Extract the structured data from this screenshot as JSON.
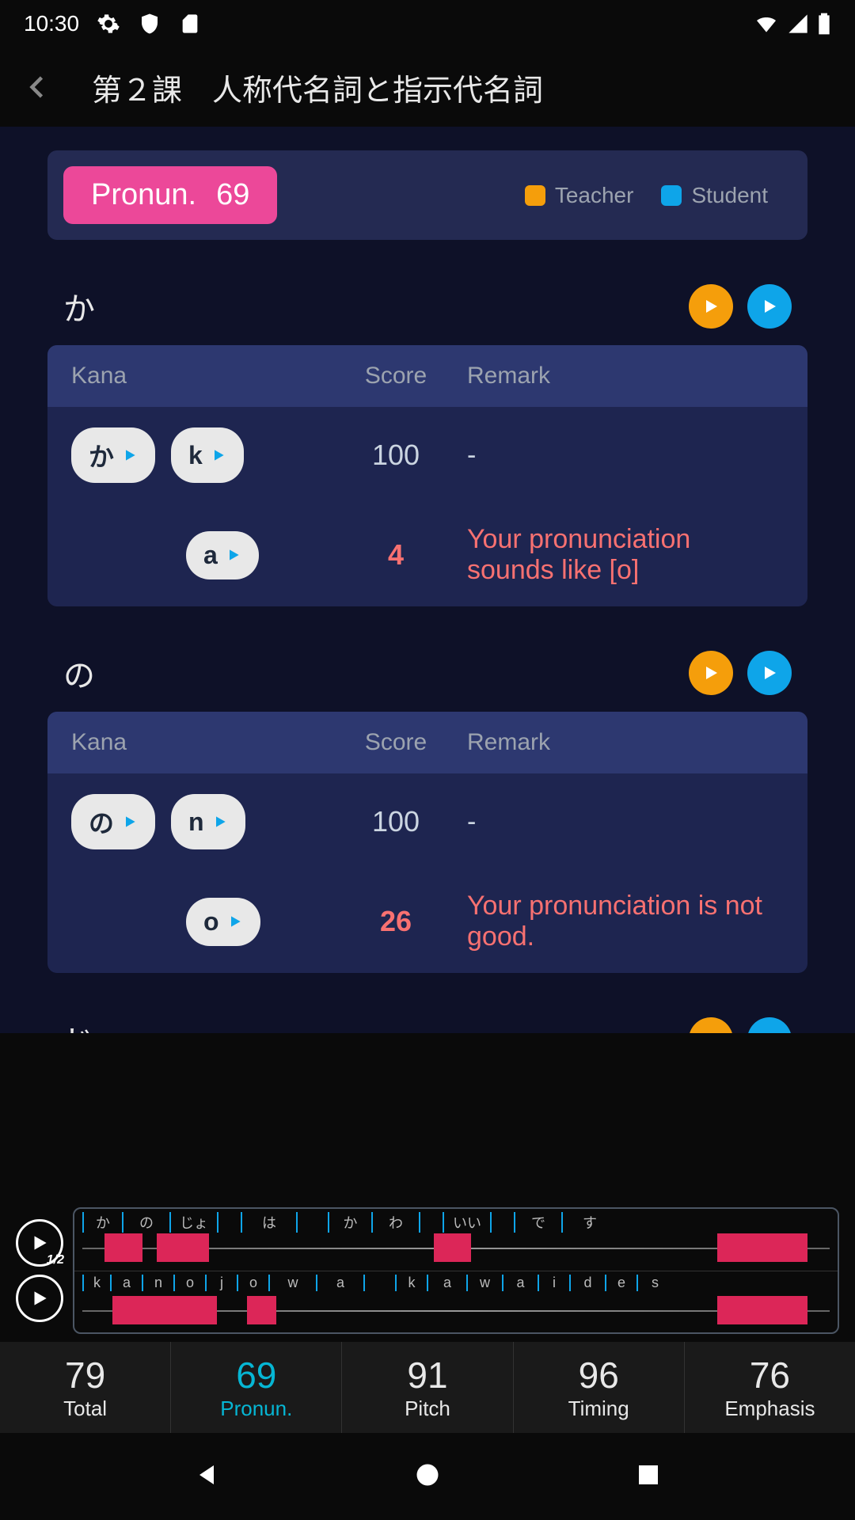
{
  "status": {
    "time": "10:30"
  },
  "header": {
    "title": "第２課　人称代名詞と指示代名詞"
  },
  "score_header": {
    "label": "Pronun.",
    "value": "69",
    "legend": {
      "teacher": "Teacher",
      "student": "Student"
    }
  },
  "table_headers": {
    "kana": "Kana",
    "score": "Score",
    "remark": "Remark"
  },
  "sections": [
    {
      "kana": "か",
      "rows": [
        {
          "kana": "か",
          "phone": "k",
          "score": "100",
          "remark": "-",
          "bad": false
        },
        {
          "phone": "a",
          "score": "4",
          "remark": "Your pronunciation sounds like [o]",
          "bad": true
        }
      ]
    },
    {
      "kana": "の",
      "rows": [
        {
          "kana": "の",
          "phone": "n",
          "score": "100",
          "remark": "-",
          "bad": false
        },
        {
          "phone": "o",
          "score": "26",
          "remark": "Your pronunciation is not good.",
          "bad": true
        }
      ]
    },
    {
      "kana": "じょ",
      "rows": []
    }
  ],
  "waveform": {
    "half_label": "1/2",
    "top_segments": [
      "か",
      "の",
      "じょ",
      "",
      "は",
      "",
      "か",
      "わ",
      "",
      "いい",
      "",
      "で",
      "す"
    ],
    "bottom_segments": [
      "k",
      "a",
      "n",
      "o",
      "j",
      "o",
      "w",
      "a",
      "",
      "k",
      "a",
      "w",
      "a",
      "i",
      "d",
      "e",
      "s"
    ]
  },
  "bottom_scores": [
    {
      "value": "79",
      "label": "Total",
      "active": false
    },
    {
      "value": "69",
      "label": "Pronun.",
      "active": true
    },
    {
      "value": "91",
      "label": "Pitch",
      "active": false
    },
    {
      "value": "96",
      "label": "Timing",
      "active": false
    },
    {
      "value": "76",
      "label": "Emphasis",
      "active": false
    }
  ]
}
